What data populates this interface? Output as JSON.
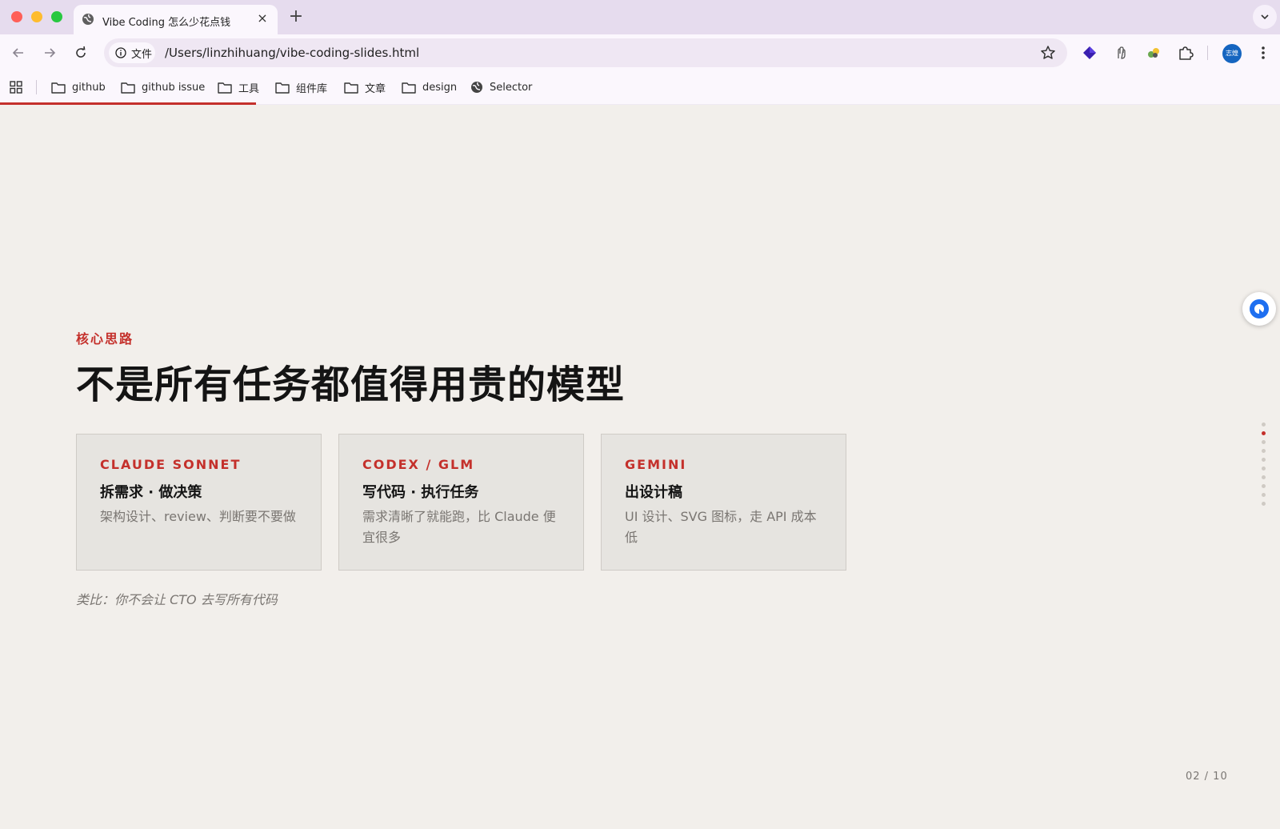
{
  "browser": {
    "tab_title": "Vibe Coding 怎么少花点钱",
    "tab_close": "×",
    "new_tab": "+",
    "tab_menu": "⌄",
    "site_chip": "文件",
    "url": "/Users/linzhihuang/vibe-coding-slides.html",
    "avatar_label": "志煌",
    "bookmarks": [
      {
        "label": "github",
        "icon": "folder-icon"
      },
      {
        "label": "github issue",
        "icon": "folder-icon"
      },
      {
        "label": "工具",
        "icon": "folder-icon"
      },
      {
        "label": "组件库",
        "icon": "folder-icon"
      },
      {
        "label": "文章",
        "icon": "folder-icon"
      },
      {
        "label": "design",
        "icon": "folder-icon"
      },
      {
        "label": "Selector",
        "icon": "globe-icon"
      }
    ],
    "progress_fraction": 0.2
  },
  "slide": {
    "eyebrow": "核心思路",
    "headline": "不是所有任务都值得用贵的模型",
    "cards": [
      {
        "model": "CLAUDE SONNET",
        "role": "拆需求 · 做决策",
        "desc": "架构设计、review、判断要不要做"
      },
      {
        "model": "CODEX / GLM",
        "role": "写代码 · 执行任务",
        "desc": "需求清晰了就能跑，比 Claude 便宜很多"
      },
      {
        "model": "GEMINI",
        "role": "出设计稿",
        "desc": "UI 设计、SVG 图标，走 API 成本低"
      }
    ],
    "analogy": "类比：你不会让 CTO 去写所有代码",
    "page_indicator": "02 / 10",
    "current_slide": 2,
    "total_slides": 10
  },
  "colors": {
    "accent": "#c4302b",
    "slide_bg": "#f2efeb",
    "card_bg": "#e6e4e0",
    "chrome_bg": "#fbf7fd",
    "titlebar_bg": "#e6dcee"
  }
}
